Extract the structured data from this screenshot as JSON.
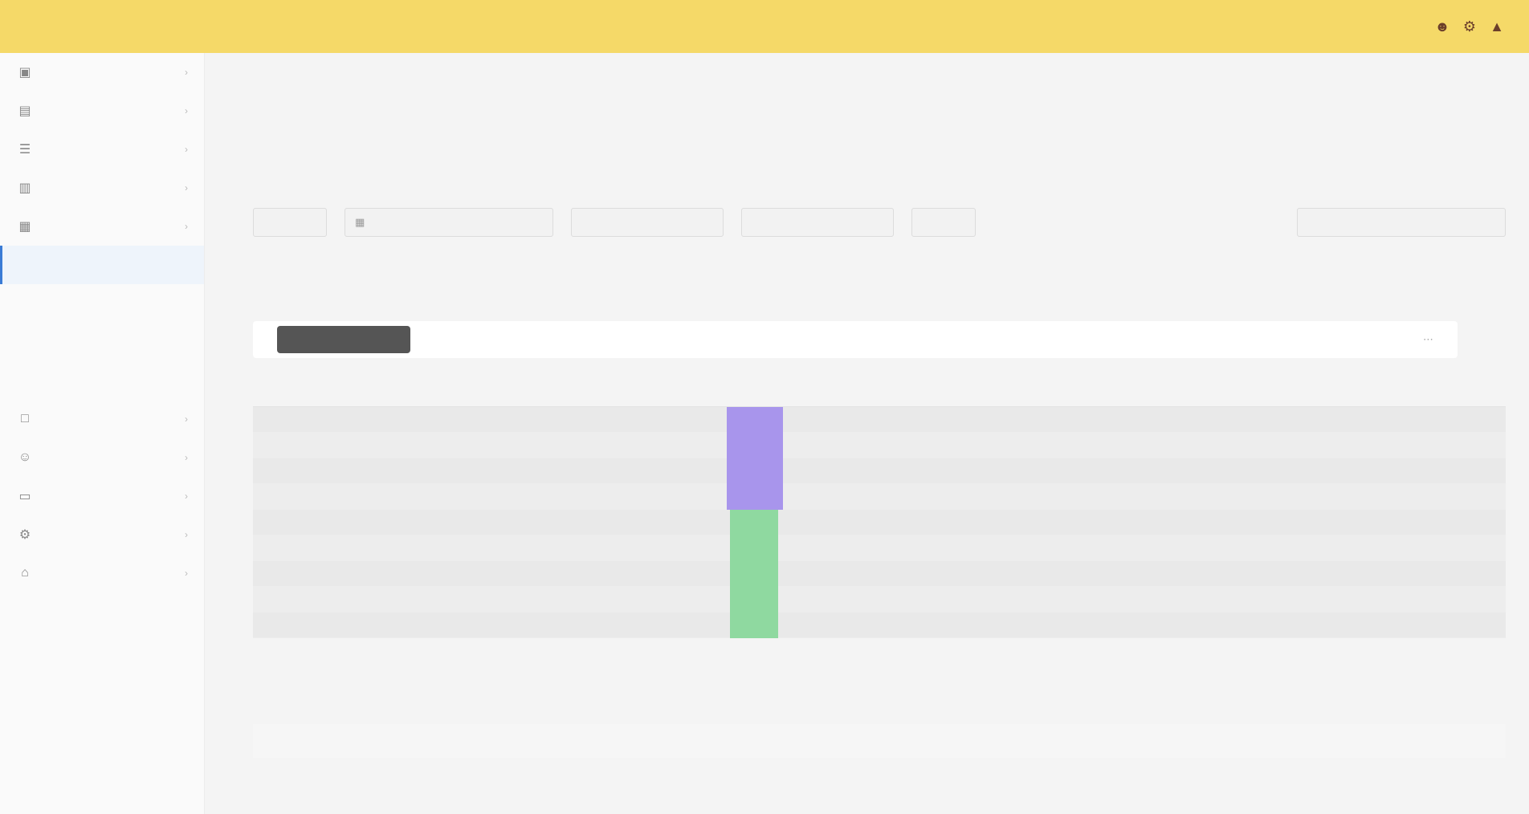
{
  "header": {
    "logo": "",
    "link": "",
    "icons": [
      "user-icon",
      "settings-icon",
      "bell-icon"
    ]
  },
  "sidebar": {
    "items": [
      {
        "label": "",
        "icon": "dashboard-icon",
        "arrow": true
      },
      {
        "label": "",
        "icon": "folder-icon",
        "arrow": true
      },
      {
        "label": "",
        "icon": "list-icon",
        "arrow": true
      },
      {
        "label": "",
        "icon": "chart-icon",
        "arrow": true
      },
      {
        "label": "",
        "icon": "grid-icon",
        "arrow": true
      },
      {
        "label": "",
        "icon": "",
        "sub": true,
        "active": true
      },
      {
        "label": "",
        "icon": "",
        "sub": true
      },
      {
        "label": "",
        "icon": "",
        "sub": true
      },
      {
        "label": "",
        "icon": "",
        "sub": true
      },
      {
        "label": "",
        "icon": "box-icon",
        "arrow": true
      },
      {
        "label": "",
        "icon": "users-icon",
        "arrow": true
      },
      {
        "label": "",
        "icon": "document-icon",
        "arrow": true
      },
      {
        "label": "",
        "icon": "settings-icon",
        "arrow": true
      },
      {
        "label": "",
        "icon": "home-icon",
        "arrow": true
      }
    ]
  },
  "breadcrumb": {
    "items": [
      "",
      "",
      ""
    ]
  },
  "page": {
    "title": ""
  },
  "filters": [
    {
      "label": "",
      "icon": ""
    },
    {
      "label": "",
      "icon": "calendar-icon"
    },
    {
      "label": "",
      "icon": ""
    },
    {
      "label": "",
      "icon": ""
    },
    {
      "label": "",
      "icon": ""
    },
    {
      "label": "",
      "icon": ""
    }
  ],
  "tabs": [
    {
      "label": "",
      "active": true
    },
    {
      "label": "",
      "active": false
    }
  ],
  "table": {
    "columns": [
      "",
      "",
      "",
      "",
      "",
      "",
      "",
      "",
      "",
      ""
    ],
    "rows": [
      [
        "",
        "",
        "",
        "",
        "purple",
        "",
        "",
        "",
        "",
        ""
      ],
      [
        "",
        "",
        "",
        "",
        "purple",
        "",
        "",
        "",
        "",
        ""
      ],
      [
        "",
        "",
        "",
        "",
        "purple",
        "",
        "",
        "",
        "",
        ""
      ],
      [
        "",
        "",
        "",
        "",
        "purple",
        "",
        "",
        "",
        "",
        ""
      ],
      [
        "",
        "",
        "",
        "",
        "green",
        "",
        "",
        "",
        "",
        ""
      ],
      [
        "",
        "",
        "",
        "",
        "green",
        "",
        "",
        "",
        "",
        ""
      ],
      [
        "",
        "",
        "",
        "",
        "green",
        "",
        "",
        "",
        "",
        ""
      ],
      [
        "",
        "",
        "",
        "",
        "green",
        "",
        "",
        "",
        "",
        ""
      ],
      [
        "",
        "",
        "",
        "",
        "green",
        "",
        "",
        "",
        "",
        ""
      ]
    ]
  },
  "pager": {
    "total": "",
    "page": "",
    "size": ""
  },
  "colors": {
    "topbar": "#f5d968",
    "purple": "#a895ec",
    "green": "#8fd9a0",
    "active": "#3a7bd5"
  }
}
